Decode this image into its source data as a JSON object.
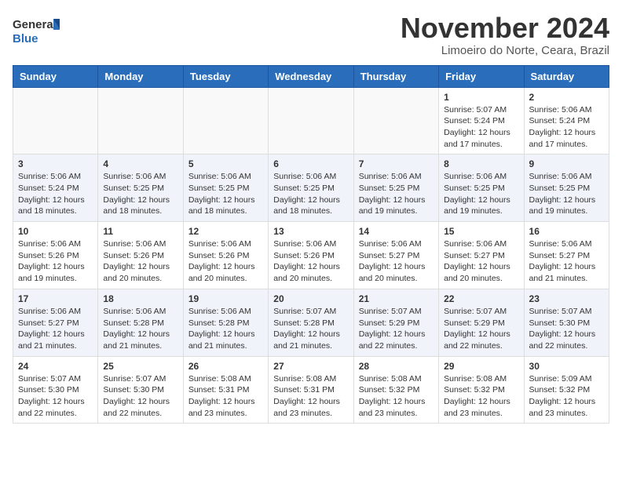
{
  "header": {
    "logo_general": "General",
    "logo_blue": "Blue",
    "month_title": "November 2024",
    "location": "Limoeiro do Norte, Ceara, Brazil"
  },
  "days_of_week": [
    "Sunday",
    "Monday",
    "Tuesday",
    "Wednesday",
    "Thursday",
    "Friday",
    "Saturday"
  ],
  "weeks": [
    [
      {
        "day": "",
        "empty": true
      },
      {
        "day": "",
        "empty": true
      },
      {
        "day": "",
        "empty": true
      },
      {
        "day": "",
        "empty": true
      },
      {
        "day": "",
        "empty": true
      },
      {
        "day": "1",
        "sunrise": "5:07 AM",
        "sunset": "5:24 PM",
        "daylight": "12 hours and 17 minutes."
      },
      {
        "day": "2",
        "sunrise": "5:06 AM",
        "sunset": "5:24 PM",
        "daylight": "12 hours and 17 minutes."
      }
    ],
    [
      {
        "day": "3",
        "sunrise": "5:06 AM",
        "sunset": "5:24 PM",
        "daylight": "12 hours and 18 minutes."
      },
      {
        "day": "4",
        "sunrise": "5:06 AM",
        "sunset": "5:25 PM",
        "daylight": "12 hours and 18 minutes."
      },
      {
        "day": "5",
        "sunrise": "5:06 AM",
        "sunset": "5:25 PM",
        "daylight": "12 hours and 18 minutes."
      },
      {
        "day": "6",
        "sunrise": "5:06 AM",
        "sunset": "5:25 PM",
        "daylight": "12 hours and 18 minutes."
      },
      {
        "day": "7",
        "sunrise": "5:06 AM",
        "sunset": "5:25 PM",
        "daylight": "12 hours and 19 minutes."
      },
      {
        "day": "8",
        "sunrise": "5:06 AM",
        "sunset": "5:25 PM",
        "daylight": "12 hours and 19 minutes."
      },
      {
        "day": "9",
        "sunrise": "5:06 AM",
        "sunset": "5:25 PM",
        "daylight": "12 hours and 19 minutes."
      }
    ],
    [
      {
        "day": "10",
        "sunrise": "5:06 AM",
        "sunset": "5:26 PM",
        "daylight": "12 hours and 19 minutes."
      },
      {
        "day": "11",
        "sunrise": "5:06 AM",
        "sunset": "5:26 PM",
        "daylight": "12 hours and 20 minutes."
      },
      {
        "day": "12",
        "sunrise": "5:06 AM",
        "sunset": "5:26 PM",
        "daylight": "12 hours and 20 minutes."
      },
      {
        "day": "13",
        "sunrise": "5:06 AM",
        "sunset": "5:26 PM",
        "daylight": "12 hours and 20 minutes."
      },
      {
        "day": "14",
        "sunrise": "5:06 AM",
        "sunset": "5:27 PM",
        "daylight": "12 hours and 20 minutes."
      },
      {
        "day": "15",
        "sunrise": "5:06 AM",
        "sunset": "5:27 PM",
        "daylight": "12 hours and 20 minutes."
      },
      {
        "day": "16",
        "sunrise": "5:06 AM",
        "sunset": "5:27 PM",
        "daylight": "12 hours and 21 minutes."
      }
    ],
    [
      {
        "day": "17",
        "sunrise": "5:06 AM",
        "sunset": "5:27 PM",
        "daylight": "12 hours and 21 minutes."
      },
      {
        "day": "18",
        "sunrise": "5:06 AM",
        "sunset": "5:28 PM",
        "daylight": "12 hours and 21 minutes."
      },
      {
        "day": "19",
        "sunrise": "5:06 AM",
        "sunset": "5:28 PM",
        "daylight": "12 hours and 21 minutes."
      },
      {
        "day": "20",
        "sunrise": "5:07 AM",
        "sunset": "5:28 PM",
        "daylight": "12 hours and 21 minutes."
      },
      {
        "day": "21",
        "sunrise": "5:07 AM",
        "sunset": "5:29 PM",
        "daylight": "12 hours and 22 minutes."
      },
      {
        "day": "22",
        "sunrise": "5:07 AM",
        "sunset": "5:29 PM",
        "daylight": "12 hours and 22 minutes."
      },
      {
        "day": "23",
        "sunrise": "5:07 AM",
        "sunset": "5:30 PM",
        "daylight": "12 hours and 22 minutes."
      }
    ],
    [
      {
        "day": "24",
        "sunrise": "5:07 AM",
        "sunset": "5:30 PM",
        "daylight": "12 hours and 22 minutes."
      },
      {
        "day": "25",
        "sunrise": "5:07 AM",
        "sunset": "5:30 PM",
        "daylight": "12 hours and 22 minutes."
      },
      {
        "day": "26",
        "sunrise": "5:08 AM",
        "sunset": "5:31 PM",
        "daylight": "12 hours and 23 minutes."
      },
      {
        "day": "27",
        "sunrise": "5:08 AM",
        "sunset": "5:31 PM",
        "daylight": "12 hours and 23 minutes."
      },
      {
        "day": "28",
        "sunrise": "5:08 AM",
        "sunset": "5:32 PM",
        "daylight": "12 hours and 23 minutes."
      },
      {
        "day": "29",
        "sunrise": "5:08 AM",
        "sunset": "5:32 PM",
        "daylight": "12 hours and 23 minutes."
      },
      {
        "day": "30",
        "sunrise": "5:09 AM",
        "sunset": "5:32 PM",
        "daylight": "12 hours and 23 minutes."
      }
    ]
  ],
  "labels": {
    "sunrise": "Sunrise:",
    "sunset": "Sunset:",
    "daylight": "Daylight:"
  }
}
